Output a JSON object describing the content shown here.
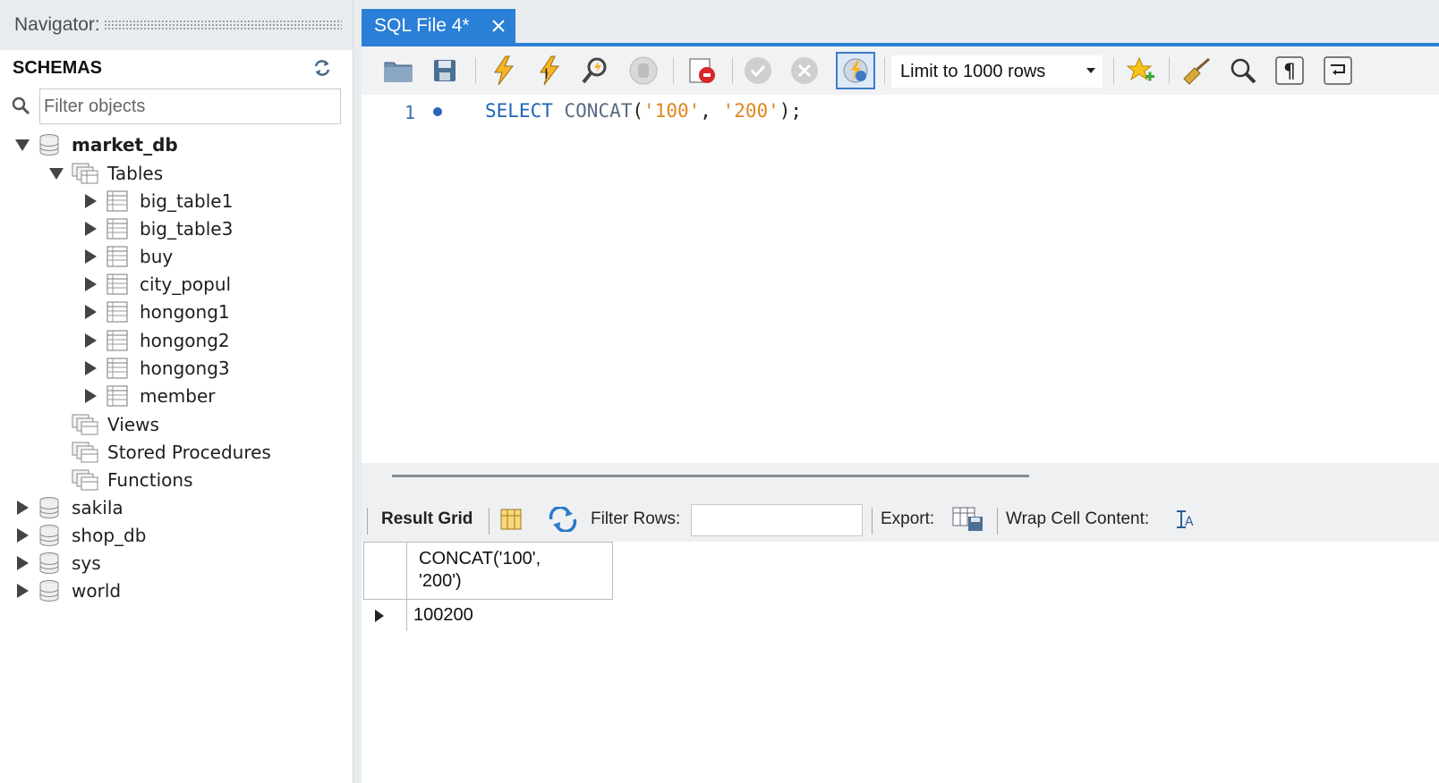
{
  "navigator": {
    "title": "Navigator:",
    "schemas_label": "SCHEMAS",
    "filter_placeholder": "Filter objects",
    "tree": {
      "market_db": "market_db",
      "tables_label": "Tables",
      "tables": [
        "big_table1",
        "big_table3",
        "buy",
        "city_popul",
        "hongong1",
        "hongong2",
        "hongong3",
        "member"
      ],
      "views_label": "Views",
      "procedures_label": "Stored Procedures",
      "functions_label": "Functions",
      "other_schemas": [
        "sakila",
        "shop_db",
        "sys",
        "world"
      ]
    }
  },
  "editor": {
    "tab_label": "SQL File 4*",
    "limit_label": "Limit to 1000 rows",
    "line_number": "1",
    "code": {
      "select": "SELECT",
      "concat": "CONCAT",
      "open": "(",
      "arg1": "'100'",
      "comma": ", ",
      "arg2": "'200'",
      "close": ");"
    }
  },
  "results": {
    "result_grid_label": "Result Grid",
    "filter_rows_label": "Filter Rows:",
    "export_label": "Export:",
    "wrap_label": "Wrap Cell Content:",
    "column_header_line1": "CONCAT('100',",
    "column_header_line2": "'200')",
    "rows": [
      "100200"
    ]
  },
  "colors": {
    "accent_blue": "#2a7fd6",
    "keyword": "#1f63b5",
    "string": "#e0861b"
  }
}
